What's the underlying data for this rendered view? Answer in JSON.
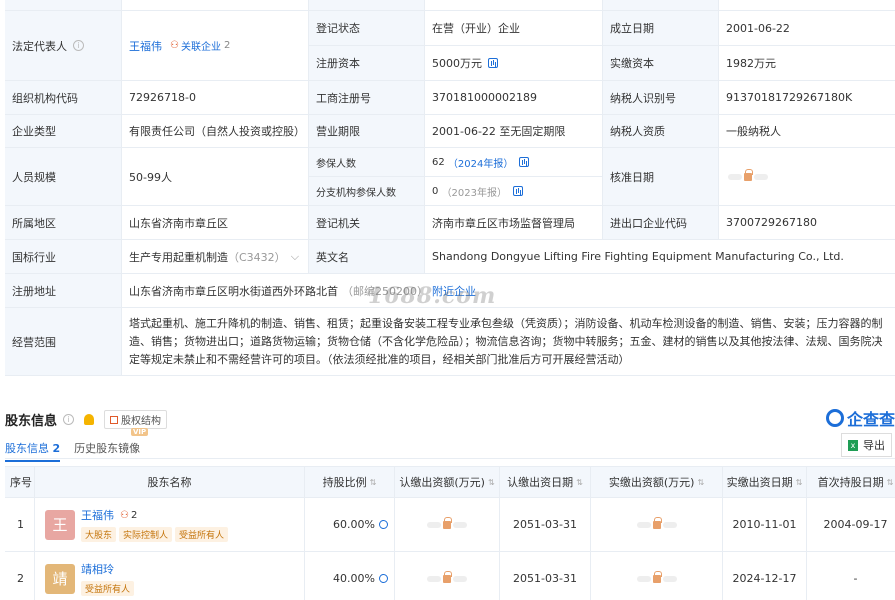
{
  "watermark": "1688.com",
  "info": {
    "legal_rep_label": "法定代表人",
    "legal_rep_name": "王福伟",
    "legal_rep_tag": "关联企业",
    "legal_rep_tag_count": "2",
    "reg_status_label": "登记状态",
    "reg_status": "在营（开业）企业",
    "established_label": "成立日期",
    "established": "2001-06-22",
    "reg_capital_label": "注册资本",
    "reg_capital": "5000万元",
    "paid_capital_label": "实缴资本",
    "paid_capital": "1982万元",
    "org_code_label": "组织机构代码",
    "org_code": "72926718-0",
    "biz_reg_label": "工商注册号",
    "biz_reg": "370181000002189",
    "taxpayer_id_label": "纳税人识别号",
    "taxpayer_id": "91370181729267180K",
    "company_type_label": "企业类型",
    "company_type": "有限责任公司（自然人投资或控股）",
    "biz_term_label": "营业期限",
    "biz_term": "2001-06-22 至无固定期限",
    "taxpayer_qual_label": "纳税人资质",
    "taxpayer_qual": "一般纳税人",
    "staff_size_label": "人员规模",
    "staff_size": "50-99人",
    "insured_label": "参保人数",
    "insured": "62",
    "insured_year": "（2024年报）",
    "branch_insured_label": "分支机构参保人数",
    "branch_insured": "0",
    "branch_insured_year": "（2023年报）",
    "approval_date_label": "核准日期",
    "region_label": "所属地区",
    "region": "山东省济南市章丘区",
    "reg_authority_label": "登记机关",
    "reg_authority": "济南市章丘区市场监督管理局",
    "import_export_label": "进出口企业代码",
    "import_export": "3700729267180",
    "industry_label": "国标行业",
    "industry": "生产专用起重机制造",
    "industry_code": "（C3432）",
    "english_name_label": "英文名",
    "english_name": "Shandong Dongyue Lifting Fire Fighting Equipment Manufacturing Co., Ltd.",
    "reg_address_label": "注册地址",
    "reg_address": "山东省济南市章丘区明水街道西外环路北首",
    "postcode": "（邮编250200）",
    "nearby_label": "附近企业",
    "biz_scope_label": "经营范围",
    "biz_scope": "塔式起重机、施工升降机的制造、销售、租赁；起重设备安装工程专业承包叁级（凭资质）；消防设备、机动车检测设备的制造、销售、安装；压力容器的制造、销售；货物进出口；道路货物运输；货物仓储（不含化学危险品）；物流信息咨询；货物中转服务；五金、建材的销售以及其他按法律、法规、国务院决定等规定未禁止和不需经营许可的项目。（依法须经批准的项目，经相关部门批准后方可开展经营活动）"
  },
  "shareholders": {
    "title": "股东信息",
    "equity_button": "股权结构",
    "brand": "企查查",
    "tab_current": "股东信息",
    "tab_current_count": "2",
    "tab_history": "历史股东镜像",
    "vip": "VIP",
    "export_label": "导出",
    "columns": [
      "序号",
      "股东名称",
      "持股比例",
      "认缴出资额(万元)",
      "认缴出资日期",
      "实缴出资额(万元)",
      "实缴出资日期",
      "首次持股日期"
    ],
    "rows": [
      {
        "index": "1",
        "avatar_char": "王",
        "avatar_color": "#e8a7a2",
        "name": "王福伟",
        "link_count": "2",
        "badges": [
          "大股东",
          "实际控制人",
          "受益所有人"
        ],
        "ratio": "60.00%",
        "sub_date": "2051-03-31",
        "paid_date": "2010-11-01",
        "first_date": "2004-09-17"
      },
      {
        "index": "2",
        "avatar_char": "靖",
        "avatar_color": "#e3b778",
        "name": "靖相玲",
        "link_count": "",
        "badges": [
          "受益所有人"
        ],
        "ratio": "40.00%",
        "sub_date": "2051-03-31",
        "paid_date": "2024-12-17",
        "first_date": "-"
      }
    ]
  }
}
